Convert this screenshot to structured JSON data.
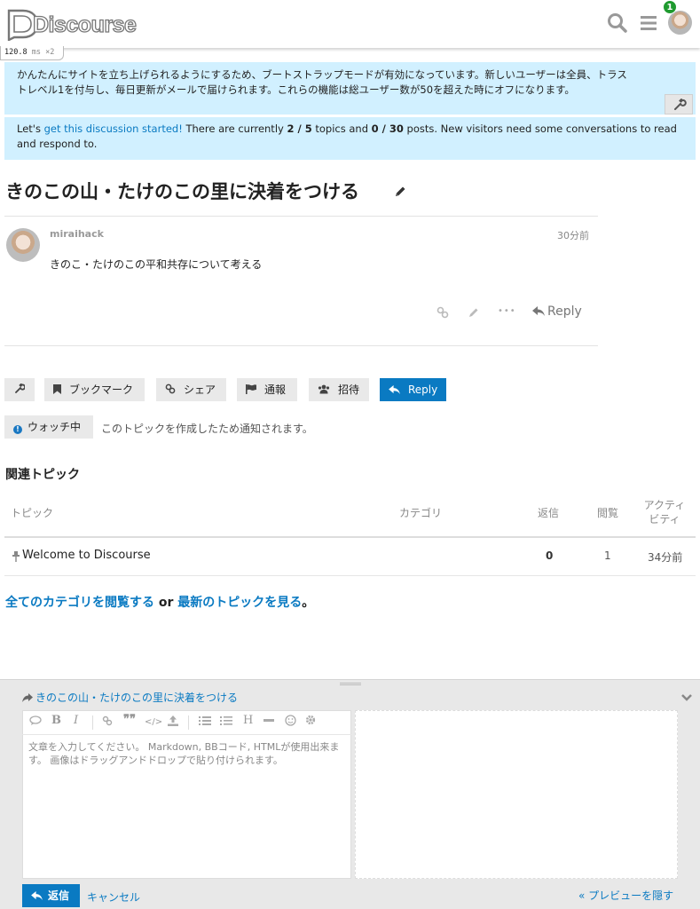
{
  "header": {
    "logo_text": "Discourse",
    "notification_count": "1"
  },
  "profiler": {
    "time": "120.8",
    "unit": "ms",
    "multiplier": "×2"
  },
  "alerts": {
    "bootstrap_line1": "かんたんにサイトを立ち上げられるようにするため、ブートストラップモードが有効になっています。新しいユーザーは全員、トラス",
    "bootstrap_line2": "トレベル1を付与し、毎日更新がメールで届けられます。これらの機能は総ユーザー数が50を超えた時にオフになります。",
    "start_prefix": "Let's ",
    "start_link": "get this discussion started!",
    "start_middle1": " There are currently ",
    "topics_count": "2 / 5",
    "start_middle2": " topics and ",
    "posts_count": "0 / 30",
    "start_suffix": " posts. New visitors need some conversations to read and respond to."
  },
  "topic": {
    "title": "きのこの山・たけのこの里に決着をつける",
    "post": {
      "username": "miraihack",
      "time": "30分前",
      "body": "きのこ・たけのこの平和共存について考える",
      "reply_label": "Reply"
    }
  },
  "footer_buttons": {
    "bookmark": "ブックマーク",
    "share": "シェア",
    "flag": "通報",
    "invite": "招待",
    "reply": "Reply",
    "watching": "ウォッチ中",
    "watching_reason": "このトピックを作成したため通知されます。"
  },
  "suggested": {
    "heading": "関連トピック",
    "columns": {
      "topic": "トピック",
      "category": "カテゴリ",
      "replies": "返信",
      "views": "閲覧",
      "activity_line1": "アクティ",
      "activity_line2": "ビティ"
    },
    "rows": [
      {
        "title": "Welcome to Discourse",
        "replies": "0",
        "views": "1",
        "activity": "34分前"
      }
    ]
  },
  "more": {
    "link1": "全てのカテゴリを閲覧する",
    "or": " or ",
    "link2": "最新のトピックを見る",
    "end": "。"
  },
  "composer": {
    "reply_to": "きのこの山・たけのこの里に決着をつける",
    "placeholder": "文章を入力してください。 Markdown, BBコード, HTMLが使用出来ます。 画像はドラッグアンドドロップで貼り付けられます。",
    "submit_label": "返信",
    "cancel_label": "キャンセル",
    "hide_preview_label": "« プレビューを隠す"
  },
  "colors": {
    "accent": "#0a7ac2",
    "alert_bg": "#d1f0ff",
    "badge_green": "#1f9a2f"
  }
}
